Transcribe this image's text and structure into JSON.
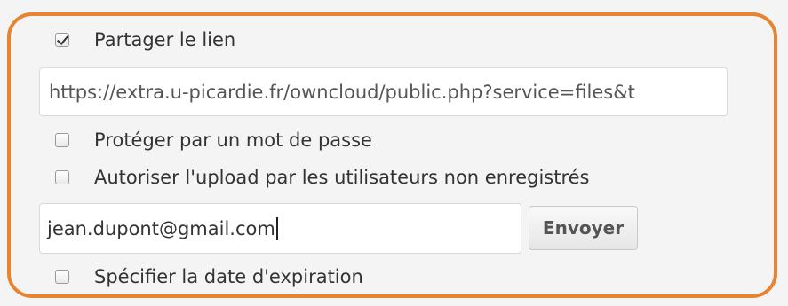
{
  "share_link": {
    "checkbox_checked": true,
    "label": "Partager le lien",
    "url_value": "https://extra.u-picardie.fr/owncloud/public.php?service=files&t"
  },
  "password_protect": {
    "checkbox_checked": false,
    "label": "Protéger par un mot de passe"
  },
  "public_upload": {
    "checkbox_checked": false,
    "label": "Autoriser l'upload par les utilisateurs non enregistrés"
  },
  "email": {
    "value": "jean.dupont@gmail.com",
    "send_label": "Envoyer"
  },
  "expiration": {
    "checkbox_checked": false,
    "label": "Spécifier la date d'expiration"
  },
  "colors": {
    "highlight_outline": "#e8832f",
    "panel_background": "#f4f4f4"
  }
}
